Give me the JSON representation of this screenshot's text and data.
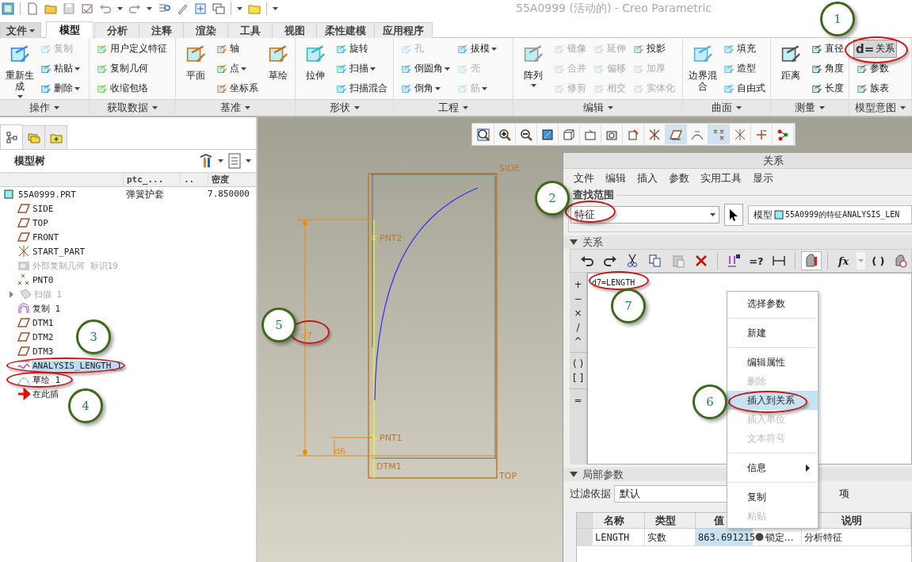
{
  "window": {
    "title": "55A0999 (活动的) - Creo Parametric"
  },
  "ribbon_tabs": [
    {
      "label": "文件",
      "selected": false,
      "dropdown": true
    },
    {
      "label": "模型",
      "selected": true,
      "dropdown": false
    },
    {
      "label": "分析",
      "selected": false,
      "dropdown": false
    },
    {
      "label": "注释",
      "selected": false,
      "dropdown": false
    },
    {
      "label": "渲染",
      "selected": false,
      "dropdown": false
    },
    {
      "label": "工具",
      "selected": false,
      "dropdown": false
    },
    {
      "label": "视图",
      "selected": false,
      "dropdown": false
    },
    {
      "label": "柔性建模",
      "selected": false,
      "dropdown": false
    },
    {
      "label": "应用程序",
      "selected": false,
      "dropdown": false
    }
  ],
  "ribbon_groups": [
    {
      "label": "操作",
      "items": [
        {
          "label": "重新生成",
          "kind": "large",
          "dropdown": true,
          "disabled": false,
          "selected": false
        },
        {
          "label": "复制",
          "kind": "small",
          "dropdown": false,
          "disabled": true,
          "selected": false
        },
        {
          "label": "粘贴",
          "kind": "small",
          "dropdown": true,
          "disabled": false,
          "selected": false
        },
        {
          "label": "删除",
          "kind": "small",
          "dropdown": true,
          "disabled": false,
          "selected": false
        }
      ]
    },
    {
      "label": "获取数据",
      "items": [
        {
          "label": "用户定义特征",
          "kind": "small",
          "dropdown": false,
          "disabled": false,
          "selected": false
        },
        {
          "label": "复制几何",
          "kind": "small",
          "dropdown": false,
          "disabled": false,
          "selected": false
        },
        {
          "label": "收缩包络",
          "kind": "small",
          "dropdown": false,
          "disabled": false,
          "selected": false
        }
      ]
    },
    {
      "label": "基准",
      "items": [
        {
          "label": "平面",
          "kind": "large",
          "dropdown": false,
          "disabled": false,
          "selected": false
        },
        {
          "label": "轴",
          "kind": "small",
          "dropdown": false,
          "disabled": false,
          "selected": false
        },
        {
          "label": "点",
          "kind": "small",
          "dropdown": true,
          "disabled": false,
          "selected": false
        },
        {
          "label": "坐标系",
          "kind": "small",
          "dropdown": false,
          "disabled": false,
          "selected": false
        },
        {
          "label": "草绘",
          "kind": "large",
          "dropdown": false,
          "disabled": false,
          "selected": false
        }
      ]
    },
    {
      "label": "形状",
      "items": [
        {
          "label": "拉伸",
          "kind": "large",
          "dropdown": false,
          "disabled": false,
          "selected": false
        },
        {
          "label": "旋转",
          "kind": "small",
          "dropdown": false,
          "disabled": false,
          "selected": false
        },
        {
          "label": "扫描",
          "kind": "small",
          "dropdown": true,
          "disabled": false,
          "selected": false
        },
        {
          "label": "扫描混合",
          "kind": "small",
          "dropdown": false,
          "disabled": false,
          "selected": false
        }
      ]
    },
    {
      "label": "工程",
      "items": [
        {
          "label": "孔",
          "kind": "small",
          "dropdown": false,
          "disabled": true,
          "selected": false
        },
        {
          "label": "倒圆角",
          "kind": "small",
          "dropdown": true,
          "disabled": false,
          "selected": false
        },
        {
          "label": "倒角",
          "kind": "small",
          "dropdown": true,
          "disabled": false,
          "selected": false
        },
        {
          "label": "拔模",
          "kind": "small",
          "dropdown": true,
          "disabled": false,
          "selected": false
        },
        {
          "label": "壳",
          "kind": "small",
          "dropdown": false,
          "disabled": true,
          "selected": false
        },
        {
          "label": "筋",
          "kind": "small",
          "dropdown": true,
          "disabled": true,
          "selected": false
        }
      ]
    },
    {
      "label": "编辑",
      "items": [
        {
          "label": "阵列",
          "kind": "large",
          "dropdown": true,
          "disabled": false,
          "selected": false
        },
        {
          "label": "镜像",
          "kind": "small",
          "dropdown": false,
          "disabled": true,
          "selected": false
        },
        {
          "label": "合并",
          "kind": "small",
          "dropdown": false,
          "disabled": true,
          "selected": false
        },
        {
          "label": "修剪",
          "kind": "small",
          "dropdown": false,
          "disabled": true,
          "selected": false
        },
        {
          "label": "延伸",
          "kind": "small",
          "dropdown": false,
          "disabled": true,
          "selected": false
        },
        {
          "label": "偏移",
          "kind": "small",
          "dropdown": false,
          "disabled": true,
          "selected": false
        },
        {
          "label": "相交",
          "kind": "small",
          "dropdown": false,
          "disabled": true,
          "selected": false
        },
        {
          "label": "投影",
          "kind": "small",
          "dropdown": false,
          "disabled": false,
          "selected": false
        },
        {
          "label": "加厚",
          "kind": "small",
          "dropdown": false,
          "disabled": true,
          "selected": false
        },
        {
          "label": "实体化",
          "kind": "small",
          "dropdown": false,
          "disabled": true,
          "selected": false
        }
      ]
    },
    {
      "label": "曲面",
      "items": [
        {
          "label": "边界混合",
          "kind": "large",
          "dropdown": false,
          "disabled": false,
          "selected": false
        },
        {
          "label": "填充",
          "kind": "small",
          "dropdown": false,
          "disabled": false,
          "selected": false
        },
        {
          "label": "造型",
          "kind": "small",
          "dropdown": false,
          "disabled": false,
          "selected": false
        },
        {
          "label": "自由式",
          "kind": "small",
          "dropdown": false,
          "disabled": false,
          "selected": false
        }
      ]
    },
    {
      "label": "测量",
      "items": [
        {
          "label": "距离",
          "kind": "large",
          "dropdown": false,
          "disabled": false,
          "selected": false
        },
        {
          "label": "直径",
          "kind": "small",
          "dropdown": false,
          "disabled": false,
          "selected": false
        },
        {
          "label": "角度",
          "kind": "small",
          "dropdown": false,
          "disabled": false,
          "selected": false
        },
        {
          "label": "长度",
          "kind": "small",
          "dropdown": false,
          "disabled": false,
          "selected": false
        }
      ]
    },
    {
      "label": "模型意图",
      "items": [
        {
          "label": "关系",
          "icon_text": "d=",
          "kind": "small",
          "dropdown": false,
          "disabled": false,
          "selected": true
        },
        {
          "label": "参数",
          "kind": "small",
          "dropdown": false,
          "disabled": false,
          "selected": false
        },
        {
          "label": "族表",
          "kind": "small",
          "dropdown": false,
          "disabled": false,
          "selected": false
        }
      ]
    }
  ],
  "model_tree": {
    "panel_tabs": [
      {
        "selected": true
      },
      {
        "selected": false
      },
      {
        "selected": false
      }
    ],
    "title": "模型树",
    "columns": [
      "ptc_...",
      "..",
      "密度"
    ],
    "items": [
      {
        "label": "55A0999.PRT",
        "kind": "part",
        "cells": [
          "弹簧护套",
          "7.850000"
        ],
        "disabled": false,
        "selected": false,
        "children": [
          {
            "label": "SIDE",
            "kind": "plane",
            "disabled": false,
            "selected": false
          },
          {
            "label": "TOP",
            "kind": "plane",
            "disabled": false,
            "selected": false
          },
          {
            "label": "FRONT",
            "kind": "plane",
            "disabled": false,
            "selected": false
          },
          {
            "label": "START_PART",
            "kind": "csys",
            "disabled": false,
            "selected": false
          },
          {
            "label": "外部复制几何 标识19",
            "kind": "copy_geom",
            "disabled": true,
            "selected": false
          },
          {
            "label": "PNT0",
            "kind": "point",
            "disabled": false,
            "selected": false
          },
          {
            "label": "扫描 1",
            "kind": "sweep",
            "disabled": true,
            "selected": false,
            "expanded": false
          },
          {
            "label": "复制 1",
            "kind": "copy",
            "disabled": false,
            "selected": false
          },
          {
            "label": "DTM1",
            "kind": "plane",
            "disabled": false,
            "selected": false
          },
          {
            "label": "DTM2",
            "kind": "plane",
            "disabled": false,
            "selected": false
          },
          {
            "label": "DTM3",
            "kind": "plane",
            "disabled": false,
            "selected": false
          },
          {
            "label": "ANALYSIS_LENGTH_1",
            "kind": "analysis",
            "disabled": false,
            "selected": true
          },
          {
            "label": "草绘 1",
            "kind": "sketch",
            "disabled": false,
            "selected": false
          },
          {
            "label": "在此插",
            "kind": "insert",
            "disabled": false,
            "selected": false
          }
        ]
      }
    ]
  },
  "graphics": {
    "labels": [
      {
        "text": "SIDE",
        "kind": "datum"
      },
      {
        "text": "PNT2",
        "kind": "datum"
      },
      {
        "text": "d7",
        "kind": "dimension"
      },
      {
        "text": "PNT1",
        "kind": "datum"
      },
      {
        "text": "d6",
        "kind": "dimension"
      },
      {
        "text": "DTM1",
        "kind": "datum"
      },
      {
        "text": "TOP",
        "kind": "datum"
      }
    ]
  },
  "relations_dialog": {
    "title": "关系",
    "menu": [
      "文件",
      "编辑",
      "插入",
      "参数",
      "实用工具",
      "显示"
    ],
    "lookup": {
      "label": "查找范围",
      "scope": "特征",
      "target_prefix": "模型",
      "target": "55A0999的特征ANALYSIS_LEN"
    },
    "relations_section": {
      "label": "关系",
      "expanded": true
    },
    "toolbar_labels": [
      "=?",
      "fx",
      "( )"
    ],
    "operators": [
      "+",
      "−",
      "×",
      "/",
      "^",
      "( )",
      "[ ]",
      "="
    ],
    "editor_text": "d7=LENGTH",
    "local_params": {
      "label": "局部参数",
      "expanded": true,
      "filter_label": "过滤依据",
      "filter_value": "默认",
      "filter_tail": "项",
      "columns": [
        {
          "label": "名称"
        },
        {
          "label": "类型"
        },
        {
          "label": "值"
        },
        {},
        {
          "label": "说明"
        }
      ],
      "rows": [
        {
          "cells": [
            {
              "text": "LENGTH",
              "kind": "text",
              "selected": false
            },
            {
              "text": "实数",
              "kind": "text",
              "selected": false
            },
            {
              "text": "863.691215",
              "kind": "text",
              "selected": true
            },
            {
              "text": "锁定...",
              "kind": "status",
              "selected": false
            },
            {
              "text": "分析特征",
              "kind": "text",
              "selected": false
            }
          ]
        }
      ]
    }
  },
  "context_menu": [
    {
      "label": "选择参数",
      "kind": "item",
      "disabled": false,
      "selected": false
    },
    {
      "kind": "separator"
    },
    {
      "label": "新建",
      "kind": "item",
      "disabled": false,
      "selected": false
    },
    {
      "kind": "separator"
    },
    {
      "label": "编辑属性",
      "kind": "item",
      "disabled": false,
      "selected": false
    },
    {
      "label": "删除",
      "kind": "item",
      "disabled": true,
      "selected": false
    },
    {
      "label": "插入到关系",
      "kind": "item",
      "disabled": false,
      "selected": true
    },
    {
      "label": "插入单位",
      "kind": "item",
      "disabled": true,
      "selected": false
    },
    {
      "label": "文本符号",
      "kind": "item",
      "disabled": true,
      "selected": false
    },
    {
      "kind": "separator"
    },
    {
      "label": "信息",
      "kind": "submenu",
      "disabled": false,
      "selected": false
    },
    {
      "kind": "separator"
    },
    {
      "label": "复制",
      "kind": "item",
      "disabled": false,
      "selected": false
    },
    {
      "label": "粘贴",
      "kind": "item",
      "disabled": true,
      "selected": false
    }
  ],
  "callouts": [
    {
      "label": "1"
    },
    {
      "label": "2"
    },
    {
      "label": "3"
    },
    {
      "label": "4"
    },
    {
      "label": "5"
    },
    {
      "label": "6"
    },
    {
      "label": "7"
    }
  ]
}
